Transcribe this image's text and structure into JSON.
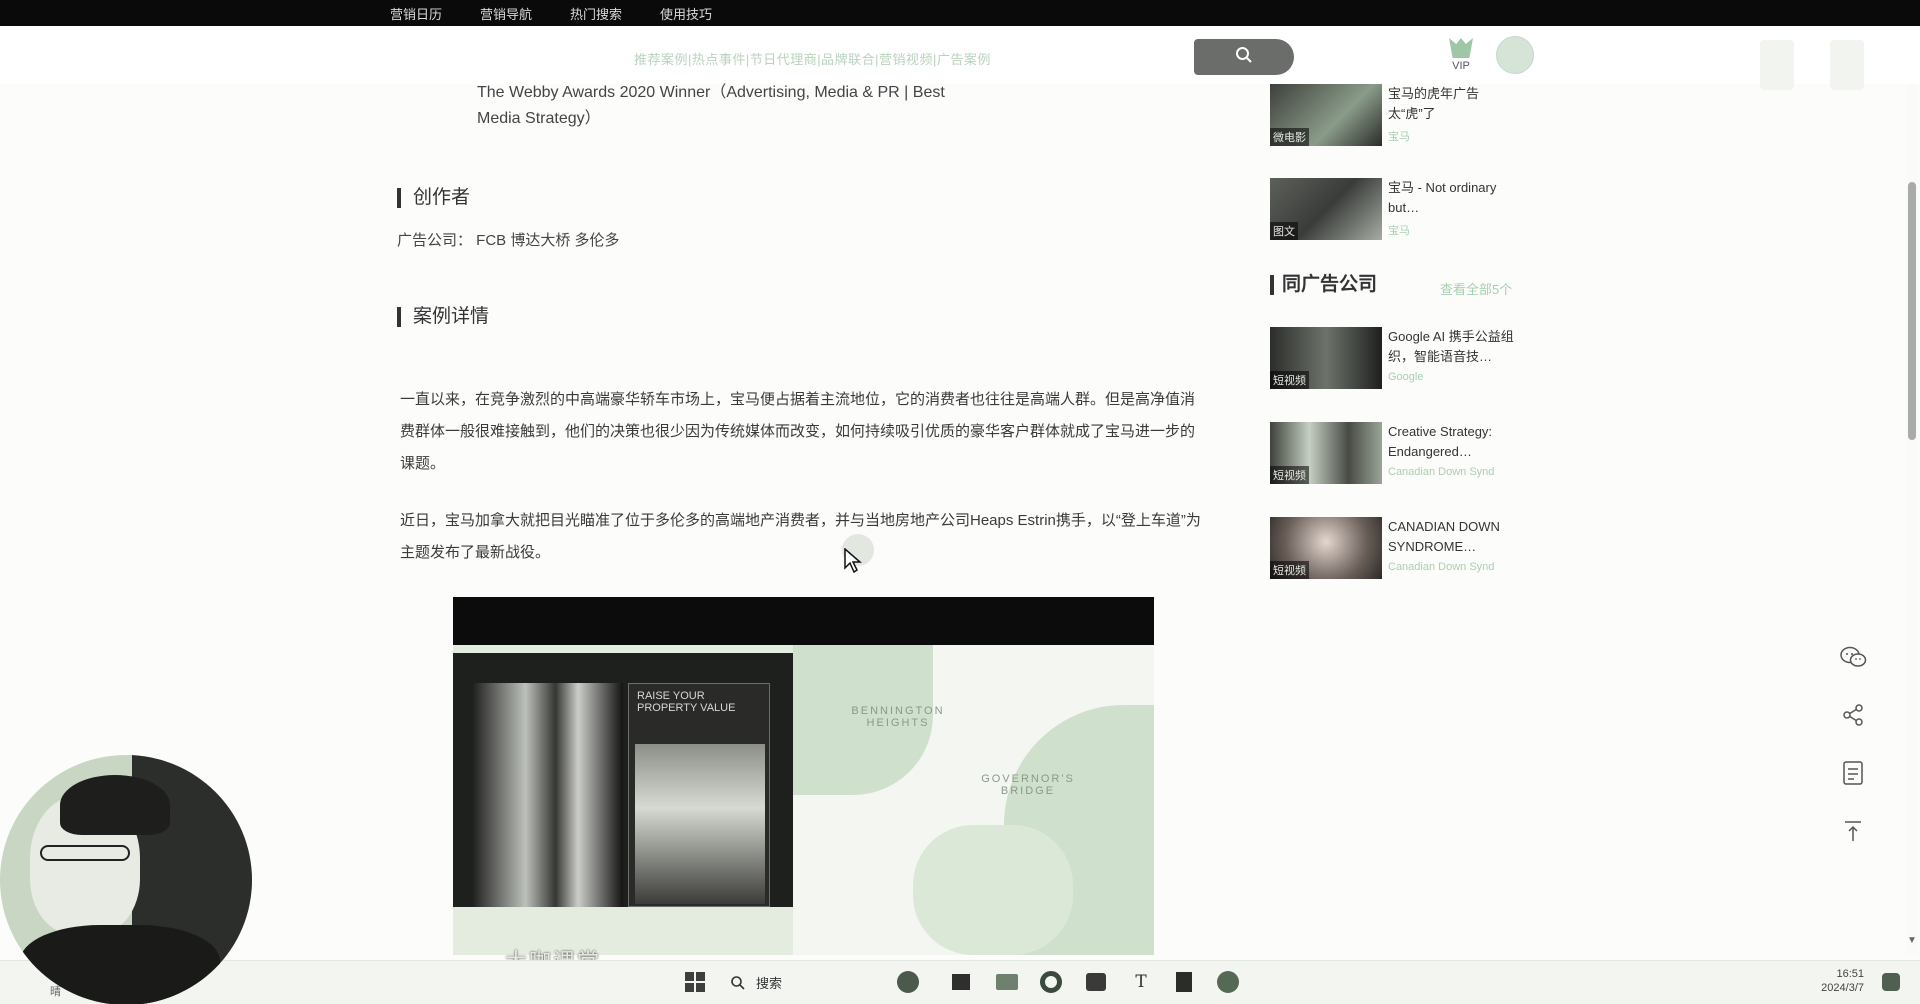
{
  "topnav": {
    "items": [
      "营销日历",
      "营销导航",
      "热门搜索",
      "使用技巧"
    ]
  },
  "header": {
    "hot_words": "推荐案例|热点事件|节日代理商|品牌联合|营销视频|广告案例",
    "vip_label": "VIP"
  },
  "article": {
    "award_text": "The Webby Awards 2020 Winner（Advertising, Media & PR | Best Media Strategy）",
    "creator_title": "创作者",
    "agency_text": "广告公司：  FCB 博达大桥 多伦多",
    "detail_title": "案例详情",
    "paragraph1": "一直以来，在竞争激烈的中高端豪华轿车市场上，宝马便占据着主流地位，它的消费者也往往是高端人群。但是高净值消费群体一般很难接触到，他们的决策也很少因为传统媒体而改变，如何持续吸引优质的豪华客户群体就成了宝马进一步的课题。",
    "paragraph2": "近日，宝马加拿大就把目光瞄准了位于多伦多的高端地产消费者，并与当地房地产公司Heaps Estrin携手，以“登上车道”为主题发布了最新战役。"
  },
  "video": {
    "ad_headline": "RAISE YOUR PROPERTY VALUE",
    "map_label_1": "BENNINGTON HEIGHTS",
    "map_label_2": "GOVERNOR'S BRIDGE",
    "watermark": "大咖课堂"
  },
  "sidebar": {
    "related_top": [
      {
        "title": "宝马的虎年广告太“虎”了",
        "brand": "宝马",
        "tag": "微电影"
      },
      {
        "title": "宝马 - Not ordinary but…",
        "brand": "宝马",
        "tag": "图文"
      }
    ],
    "same_agency_title": "同广告公司",
    "see_all": "查看全部5个",
    "same_agency": [
      {
        "title": "Google AI 携手公益组织，智能语音技…",
        "brand": "Google",
        "tag": "短视频"
      },
      {
        "title": "Creative Strategy: Endangered…",
        "brand": "Canadian Down Synd",
        "tag": "短视频"
      },
      {
        "title": "CANADIAN DOWN SYNDROME…",
        "brand": "Canadian Down Synd",
        "tag": "短视频"
      }
    ]
  },
  "taskbar": {
    "search_label": "搜索",
    "time": "16:51",
    "date": "2024/3/7",
    "left_label": "晴"
  },
  "colors": {
    "accent": "#a9cfb0",
    "topnav_bg": "#0a0a0a",
    "search_btn": "#6a6d69"
  },
  "icons": [
    "search-icon",
    "vip-gem-icon",
    "wechat-icon",
    "share-icon",
    "document-icon",
    "back-to-top-icon",
    "windows-start-icon"
  ]
}
